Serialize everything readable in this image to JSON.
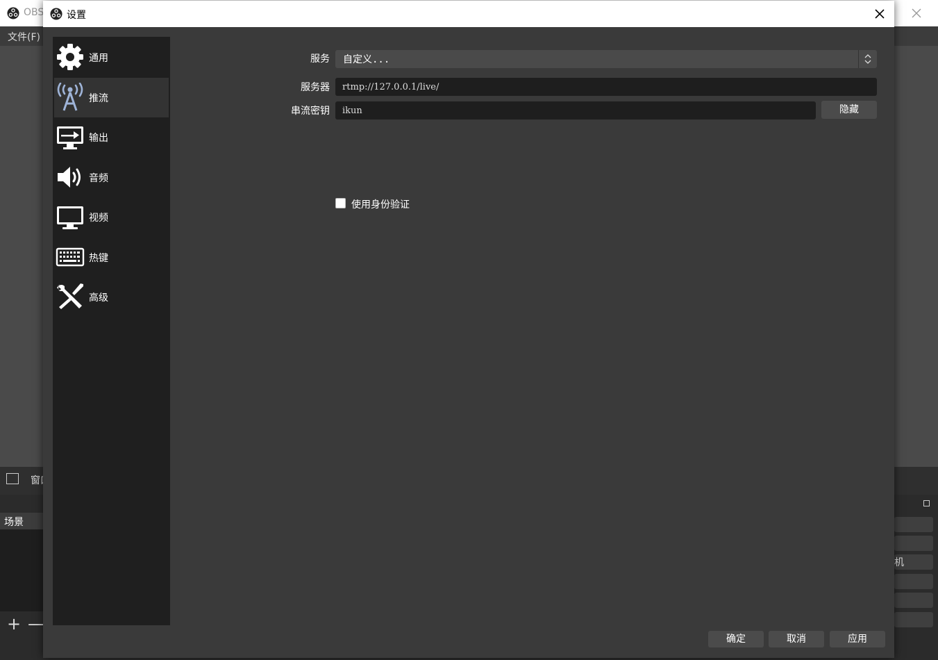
{
  "main_window": {
    "title": "OBS",
    "menu_file": "文件(F)",
    "source_toolbar_label": "窗口",
    "scenes_header": "场景",
    "add_icon_glyph": "+",
    "remove_icon_glyph": "—",
    "right_dock_visible_text": "机"
  },
  "dialog": {
    "title": "设置",
    "sidebar": {
      "items": [
        {
          "label": "通用",
          "icon": "gear-icon"
        },
        {
          "label": "推流",
          "icon": "antenna-icon",
          "active": true
        },
        {
          "label": "输出",
          "icon": "output-monitor-icon"
        },
        {
          "label": "音频",
          "icon": "speaker-icon"
        },
        {
          "label": "视频",
          "icon": "monitor-icon"
        },
        {
          "label": "热键",
          "icon": "keyboard-icon"
        },
        {
          "label": "高级",
          "icon": "tools-icon"
        }
      ]
    },
    "stream": {
      "service_label": "服务",
      "service_value": "自定义...",
      "server_label": "服务器",
      "server_value": "rtmp://127.0.0.1/live/",
      "key_label": "串流密钥",
      "key_value": "ikun",
      "hide_button": "隐藏",
      "auth_checkbox_label": "使用身份验证",
      "auth_checked": false
    },
    "footer": {
      "ok": "确定",
      "cancel": "取消",
      "apply": "应用"
    }
  },
  "colors": {
    "accent_icon": "#9fb4d8",
    "sidebar_bg": "#1f1f1f",
    "dialog_bg": "#3a3a3a"
  }
}
